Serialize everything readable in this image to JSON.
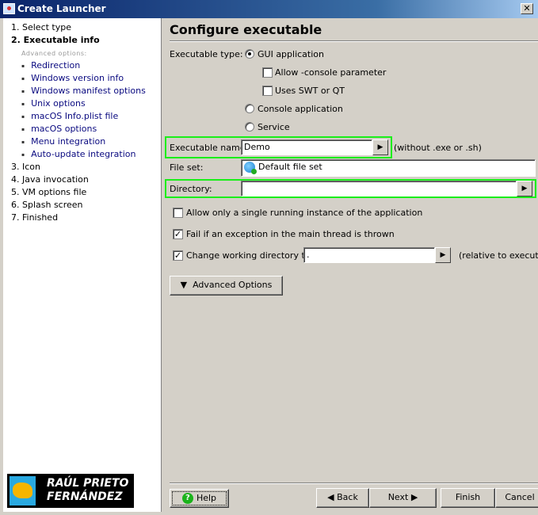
{
  "window": {
    "title": "Create Launcher",
    "close": "✕"
  },
  "steps": [
    {
      "label": "1. Select type",
      "active": false
    },
    {
      "label": "2. Executable info",
      "active": true
    },
    {
      "label": "3. Icon",
      "active": false
    },
    {
      "label": "4. Java invocation",
      "active": false
    },
    {
      "label": "5. VM options file",
      "active": false
    },
    {
      "label": "6. Splash screen",
      "active": false
    },
    {
      "label": "7. Finished",
      "active": false
    }
  ],
  "advanced_label": "Advanced options:",
  "substeps": [
    "Redirection",
    "Windows version info",
    "Windows manifest options",
    "Unix options",
    "macOS Info.plist file",
    "macOS options",
    "Menu integration",
    "Auto-update integration"
  ],
  "logo": {
    "line1": "RAÚL PRIETO",
    "line2": "FERNÁNDEZ"
  },
  "main": {
    "title": "Configure executable",
    "exe_type_label": "Executable type:",
    "gui_app": {
      "label": "GUI application",
      "selected": true
    },
    "allow_console": {
      "label": "Allow -console parameter",
      "checked": false
    },
    "uses_swt": {
      "label": "Uses SWT or QT",
      "checked": false
    },
    "console_app": {
      "label": "Console application",
      "selected": false
    },
    "service": {
      "label": "Service",
      "selected": false
    },
    "exe_name_label": "Executable name:",
    "exe_name_value": "Demo",
    "exe_name_hint": "(without .exe or .sh)",
    "file_set_label": "File set:",
    "file_set_value": "Default file set",
    "directory_label": "Directory:",
    "directory_value": "",
    "single_instance": {
      "label": "Allow only a single running instance of the application",
      "checked": false
    },
    "fail_exception": {
      "label": "Fail if an exception in the main thread is thrown",
      "checked": true
    },
    "change_dir": {
      "label": "Change working directory to:",
      "checked": true,
      "value": ".",
      "hint": "(relative to executal"
    },
    "advanced_button": "Advanced Options"
  },
  "footer": {
    "help": "Help",
    "back": "Back",
    "next": "Next",
    "finish": "Finish",
    "cancel": "Cancel"
  },
  "colors": {
    "highlight": "#1aef1a",
    "titlebar": "#0a246a",
    "panel": "#d4d0c8"
  }
}
